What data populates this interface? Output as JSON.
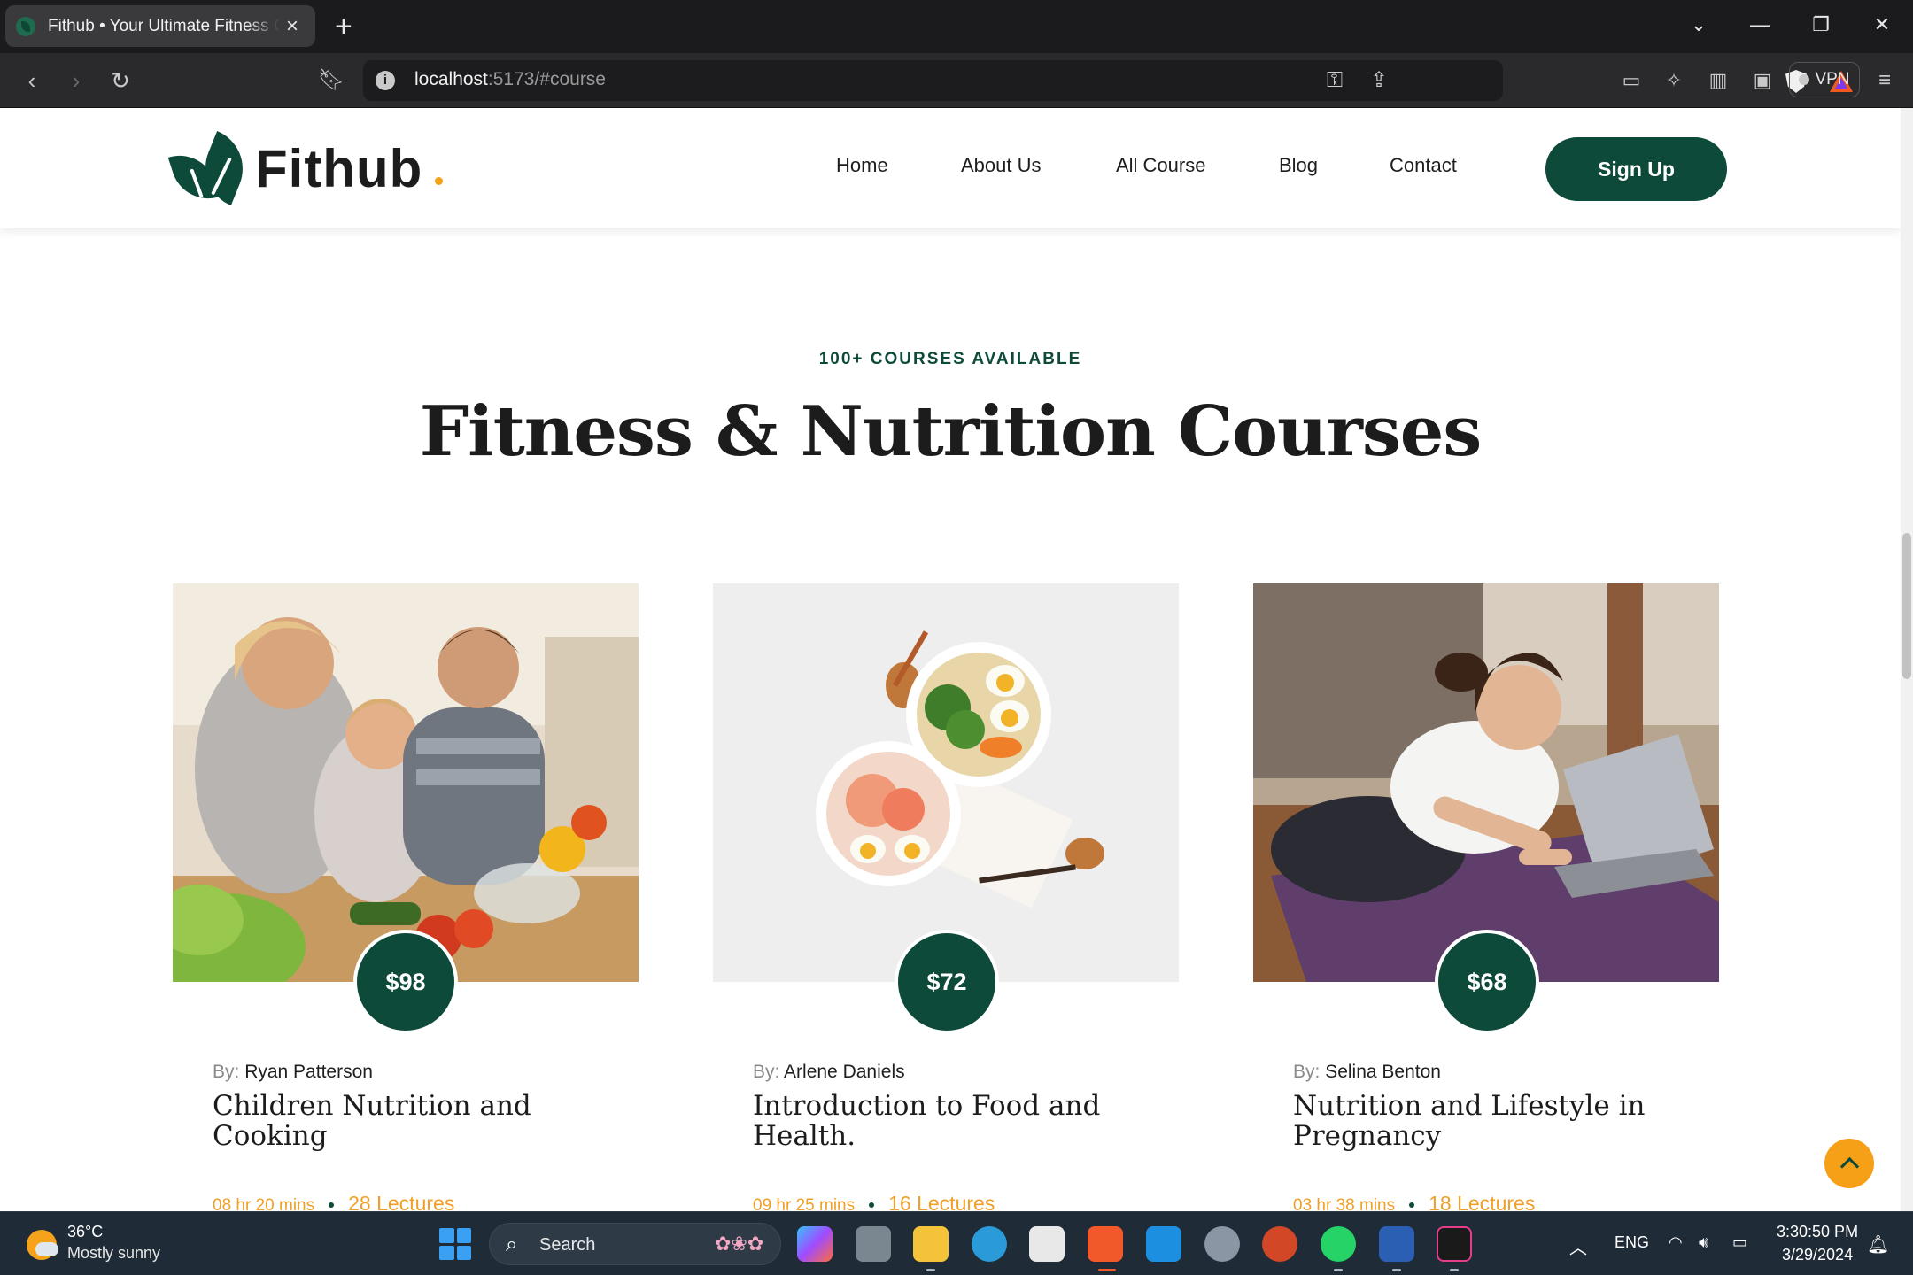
{
  "browser": {
    "tab_title": "Fithub • Your Ultimate Fitness Course",
    "tab_close": "×",
    "new_tab": "+",
    "url_host": "localhost",
    "url_rest": ":5173/#course",
    "vpn_label": "VPN"
  },
  "site": {
    "logo_text": "Fithub",
    "nav": [
      "Home",
      "About Us",
      "All Course",
      "Blog",
      "Contact"
    ],
    "signup_label": "Sign Up",
    "accent_color": "#0d4a3a",
    "highlight_color": "#f5a016"
  },
  "courses_section": {
    "eyebrow": "100+ COURSES AVAILABLE",
    "title": "Fitness & Nutrition Courses",
    "by_label": "By:",
    "cards": [
      {
        "price": "$98",
        "author": "Ryan Patterson",
        "title": "Children Nutrition and Cooking",
        "duration": "08 hr 20 mins",
        "lectures": "28 Lectures",
        "image": "family-cooking-photo"
      },
      {
        "price": "$72",
        "author": "Arlene Daniels",
        "title": "Introduction to Food and Health.",
        "duration": "09 hr 25 mins",
        "lectures": "16 Lectures",
        "image": "salad-bowls-photo"
      },
      {
        "price": "$68",
        "author": "Selina Benton",
        "title": "Nutrition and Lifestyle in Pregnancy",
        "duration": "03 hr 38 mins",
        "lectures": "18 Lectures",
        "image": "woman-laptop-yoga-photo"
      }
    ]
  },
  "taskbar": {
    "temperature": "36°C",
    "weather": "Mostly sunny",
    "search_placeholder": "Search",
    "language": "ENG",
    "time": "3:30:50 PM",
    "date": "3/29/2024"
  }
}
